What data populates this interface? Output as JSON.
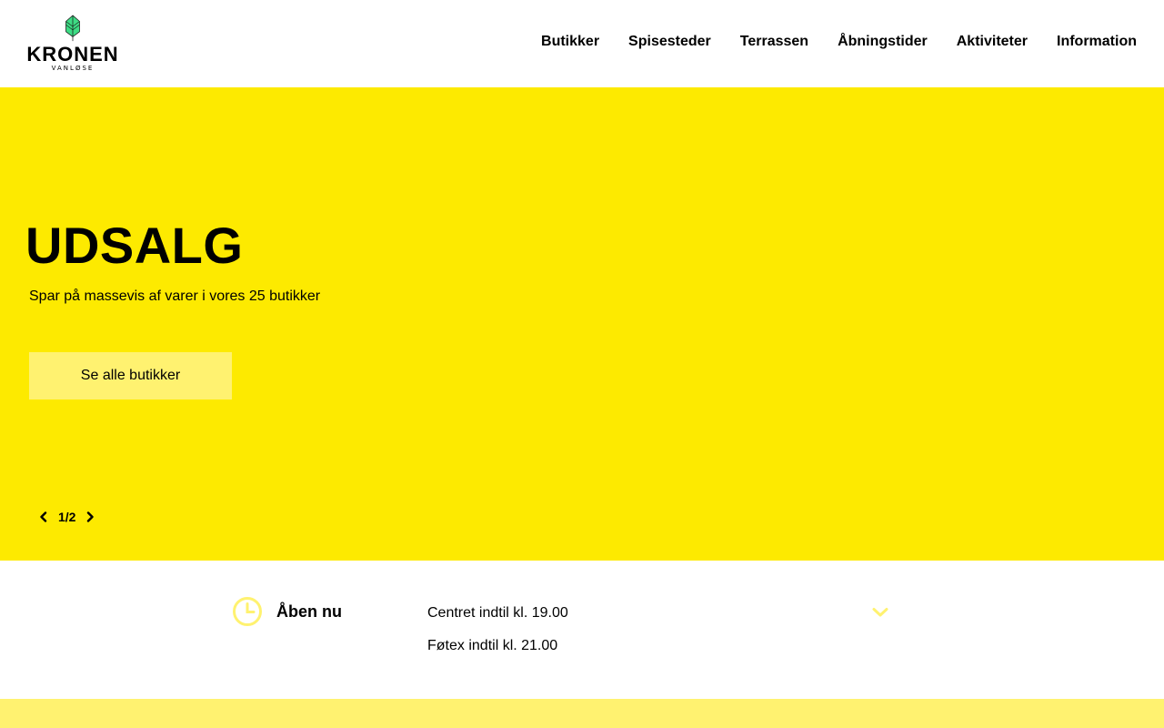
{
  "brand": {
    "name": "KRONEN",
    "sub": "VANLØSE",
    "logo_icon": "leaf-logo-icon",
    "colors": {
      "yellow": "#fdea00",
      "light_yellow": "#fff270",
      "logo_green": "#3ddc84"
    }
  },
  "nav": {
    "items": [
      {
        "label": "Butikker"
      },
      {
        "label": "Spisesteder"
      },
      {
        "label": "Terrassen"
      },
      {
        "label": "Åbningstider"
      },
      {
        "label": "Aktiviteter"
      },
      {
        "label": "Information"
      }
    ]
  },
  "hero": {
    "title": "UDSALG",
    "text": "Spar på massevis af varer i vores 25 butikker",
    "button_label": "Se alle butikker",
    "slider": {
      "counter": "1/2",
      "prev_icon": "chevron-left-icon",
      "next_icon": "chevron-right-icon"
    }
  },
  "hours": {
    "icon": "clock-icon",
    "label": "Åben nu",
    "lines": [
      "Centret indtil kl. 19.00",
      "Føtex indtil kl. 21.00"
    ],
    "toggle_icon": "chevron-down-icon"
  }
}
